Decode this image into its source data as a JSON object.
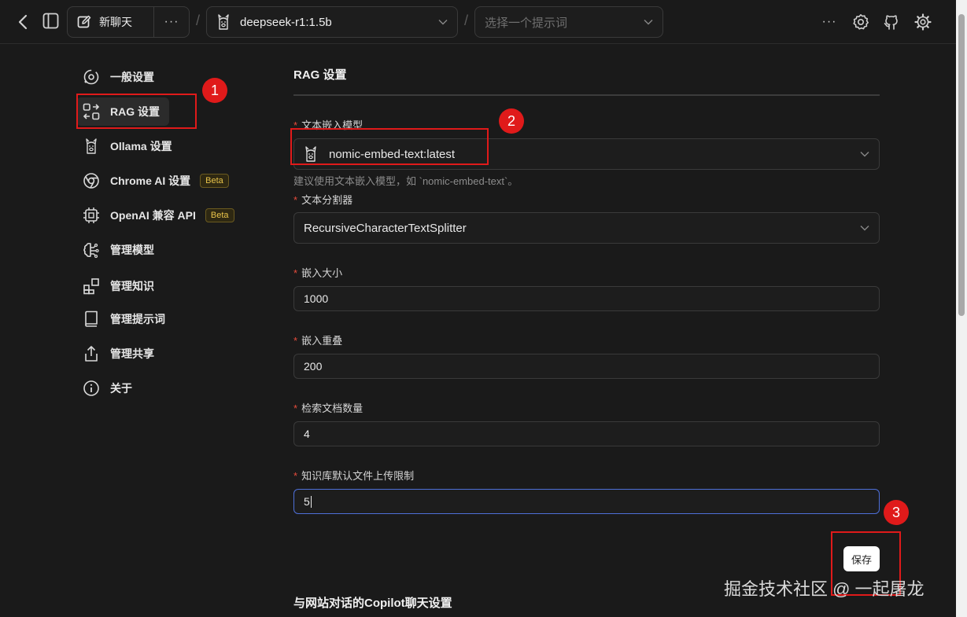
{
  "topbar": {
    "new_chat_label": "新聊天",
    "more_glyph": "···",
    "separator": "/",
    "model_selected": "deepseek-r1:1.5b",
    "prompt_placeholder": "选择一个提示词",
    "overflow_glyph": "···"
  },
  "sidebar": {
    "items": [
      {
        "label": "一般设置",
        "icon": "general-settings-icon",
        "active": false
      },
      {
        "label": "RAG 设置",
        "icon": "rag-icon",
        "active": true
      },
      {
        "label": "Ollama 设置",
        "icon": "llama-icon",
        "active": false
      },
      {
        "label": "Chrome AI 设置",
        "icon": "chrome-icon",
        "badge": "Beta",
        "active": false
      },
      {
        "label": "OpenAI 兼容 API",
        "icon": "chip-icon",
        "badge": "Beta",
        "active": false
      },
      {
        "label": "管理模型",
        "icon": "brain-icon",
        "active": false
      },
      {
        "label": "管理知识",
        "icon": "blocks-icon",
        "active": false
      },
      {
        "label": "管理提示词",
        "icon": "book-icon",
        "active": false
      },
      {
        "label": "管理共享",
        "icon": "share-icon",
        "active": false
      },
      {
        "label": "关于",
        "icon": "info-icon",
        "active": false
      }
    ]
  },
  "form": {
    "title": "RAG 设置",
    "required_mark": "*",
    "embedding_model": {
      "label": "文本嵌入模型",
      "value": "nomic-embed-text:latest",
      "help": "建议使用文本嵌入模型，如 `nomic-embed-text`。"
    },
    "splitter": {
      "label": "文本分割器",
      "value": "RecursiveCharacterTextSplitter"
    },
    "chunk_size": {
      "label": "嵌入大小",
      "value": "1000"
    },
    "chunk_overlap": {
      "label": "嵌入重叠",
      "value": "200"
    },
    "retrieval_count": {
      "label": "检索文档数量",
      "value": "4"
    },
    "upload_limit": {
      "label": "知识库默认文件上传限制",
      "value": "5"
    },
    "save_label": "保存",
    "next_section_title": "与网站对话的Copilot聊天设置"
  },
  "annotations": {
    "n1": "1",
    "n2": "2",
    "n3": "3",
    "color": "#e01a1a"
  },
  "watermark": "掘金技术社区 @ 一起屠龙"
}
